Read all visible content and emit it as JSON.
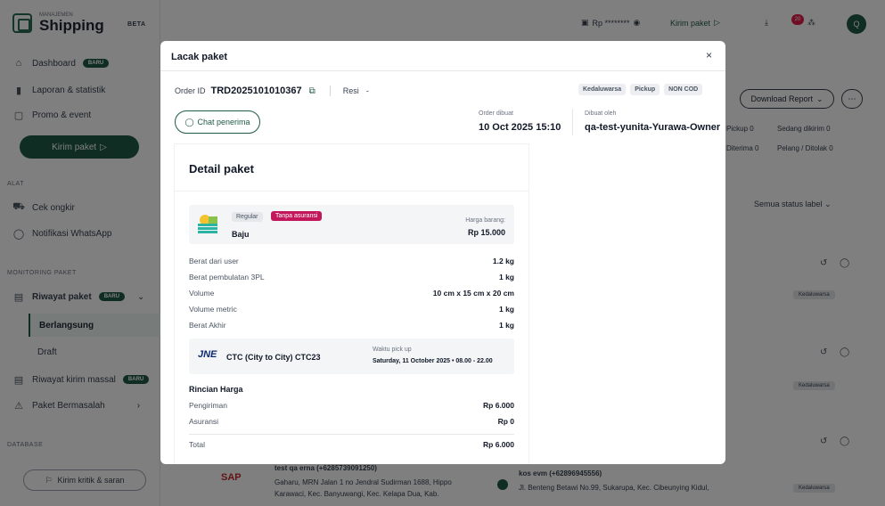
{
  "sidebar": {
    "brand_small": "MANAJEMEN",
    "brand_name": "Shipping",
    "beta": "BETA",
    "dashboard": "Dashboard",
    "dashboard_badge": "BARU",
    "laporan": "Laporan & statistik",
    "promo": "Promo & event",
    "kirim_paket": "Kirim paket",
    "alat_label": "ALAT",
    "cek_ongkir": "Cek ongkir",
    "notif_wa": "Notifikasi WhatsApp",
    "monitoring_label": "MONITORING PAKET",
    "riwayat": "Riwayat paket",
    "riwayat_badge": "BARU",
    "berlangsung": "Berlangsung",
    "draft": "Draft",
    "riwayat_massal": "Riwayat kirim massal",
    "riwayat_massal_badge": "BARU",
    "bermasalah": "Paket Bermasalah",
    "database_label": "DATABASE",
    "feedback": "Kirim kritik & saran"
  },
  "topbar": {
    "balance": "Rp ********",
    "kirim_paket": "Kirim paket",
    "notif_count": "20",
    "avatar": "Q"
  },
  "background": {
    "download_report": "Download Report",
    "pickup_stat": "Pickup",
    "pickup_count": "0",
    "sedang_dikirim": "Sedang dikirim",
    "sedang_dikirim_count": "0",
    "diterima_stat": "Diterima",
    "diterima_count": "0",
    "pelang_ditolak": "Pelang / Ditolak",
    "pelang_count": "0",
    "status_label": "Semua status label",
    "expired_badge": "Kedaluwarsa",
    "bottom_left_name": "test qa erna (+6285739091250)",
    "bottom_left_addr": "Gaharu, MRN Jalan 1 no Jendral Sudirman 1688, Hippo",
    "bottom_left_addr2": "Karawaci, Kec. Banyuwangi, Kec. Kelapa Dua, Kab.",
    "bottom_right_name": "kos evm (+62896945556)",
    "bottom_right_addr": "Jl. Benteng Betawi No.99, Sukarupa, Kec. Cibeunying Kidul,"
  },
  "modal": {
    "title": "Lacak paket",
    "close": "×",
    "order_id_label": "Order ID",
    "order_id": "TRD2025101010367",
    "resi_label": "Resi",
    "resi_value": "-",
    "tags": [
      "Kedaluwarsa",
      "Pickup",
      "NON COD"
    ],
    "chat_button": "Chat penerima",
    "order_dibuat_label": "Order dibuat",
    "order_dibuat_value": "10 Oct 2025 15:10",
    "dibuat_oleh_label": "Dibuat oleh",
    "dibuat_oleh_value": "qa-test-yunita-Yurawa-Owner",
    "detail_title": "Detail paket",
    "item": {
      "tag_regular": "Regular",
      "tag_insurance": "Tanpa asuransi",
      "name": "Baju",
      "price_label": "Harga barang:",
      "price_value": "Rp 15.000"
    },
    "specs": [
      {
        "label": "Berat dari user",
        "value": "1.2 kg"
      },
      {
        "label": "Berat pembulatan 3PL",
        "value": "1 kg"
      },
      {
        "label": "Volume",
        "value": "10 cm x 15 cm x 20 cm"
      },
      {
        "label": "Volume metric",
        "value": "1 kg"
      },
      {
        "label": "Berat Akhir",
        "value": "1 kg"
      }
    ],
    "courier": {
      "logo": "JNE",
      "name": "CTC (City to City) CTC23",
      "pickup_label": "Waktu pick up",
      "pickup_value": "Saturday, 11 October 2025 • 08.00 - 22.00"
    },
    "rincian_title": "Rincian Harga",
    "rincian": [
      {
        "label": "Pengiriman",
        "value": "Rp 6.000"
      },
      {
        "label": "Asuransi",
        "value": "Rp 0"
      }
    ],
    "total_label": "Total",
    "total_value": "Rp 6.000"
  }
}
